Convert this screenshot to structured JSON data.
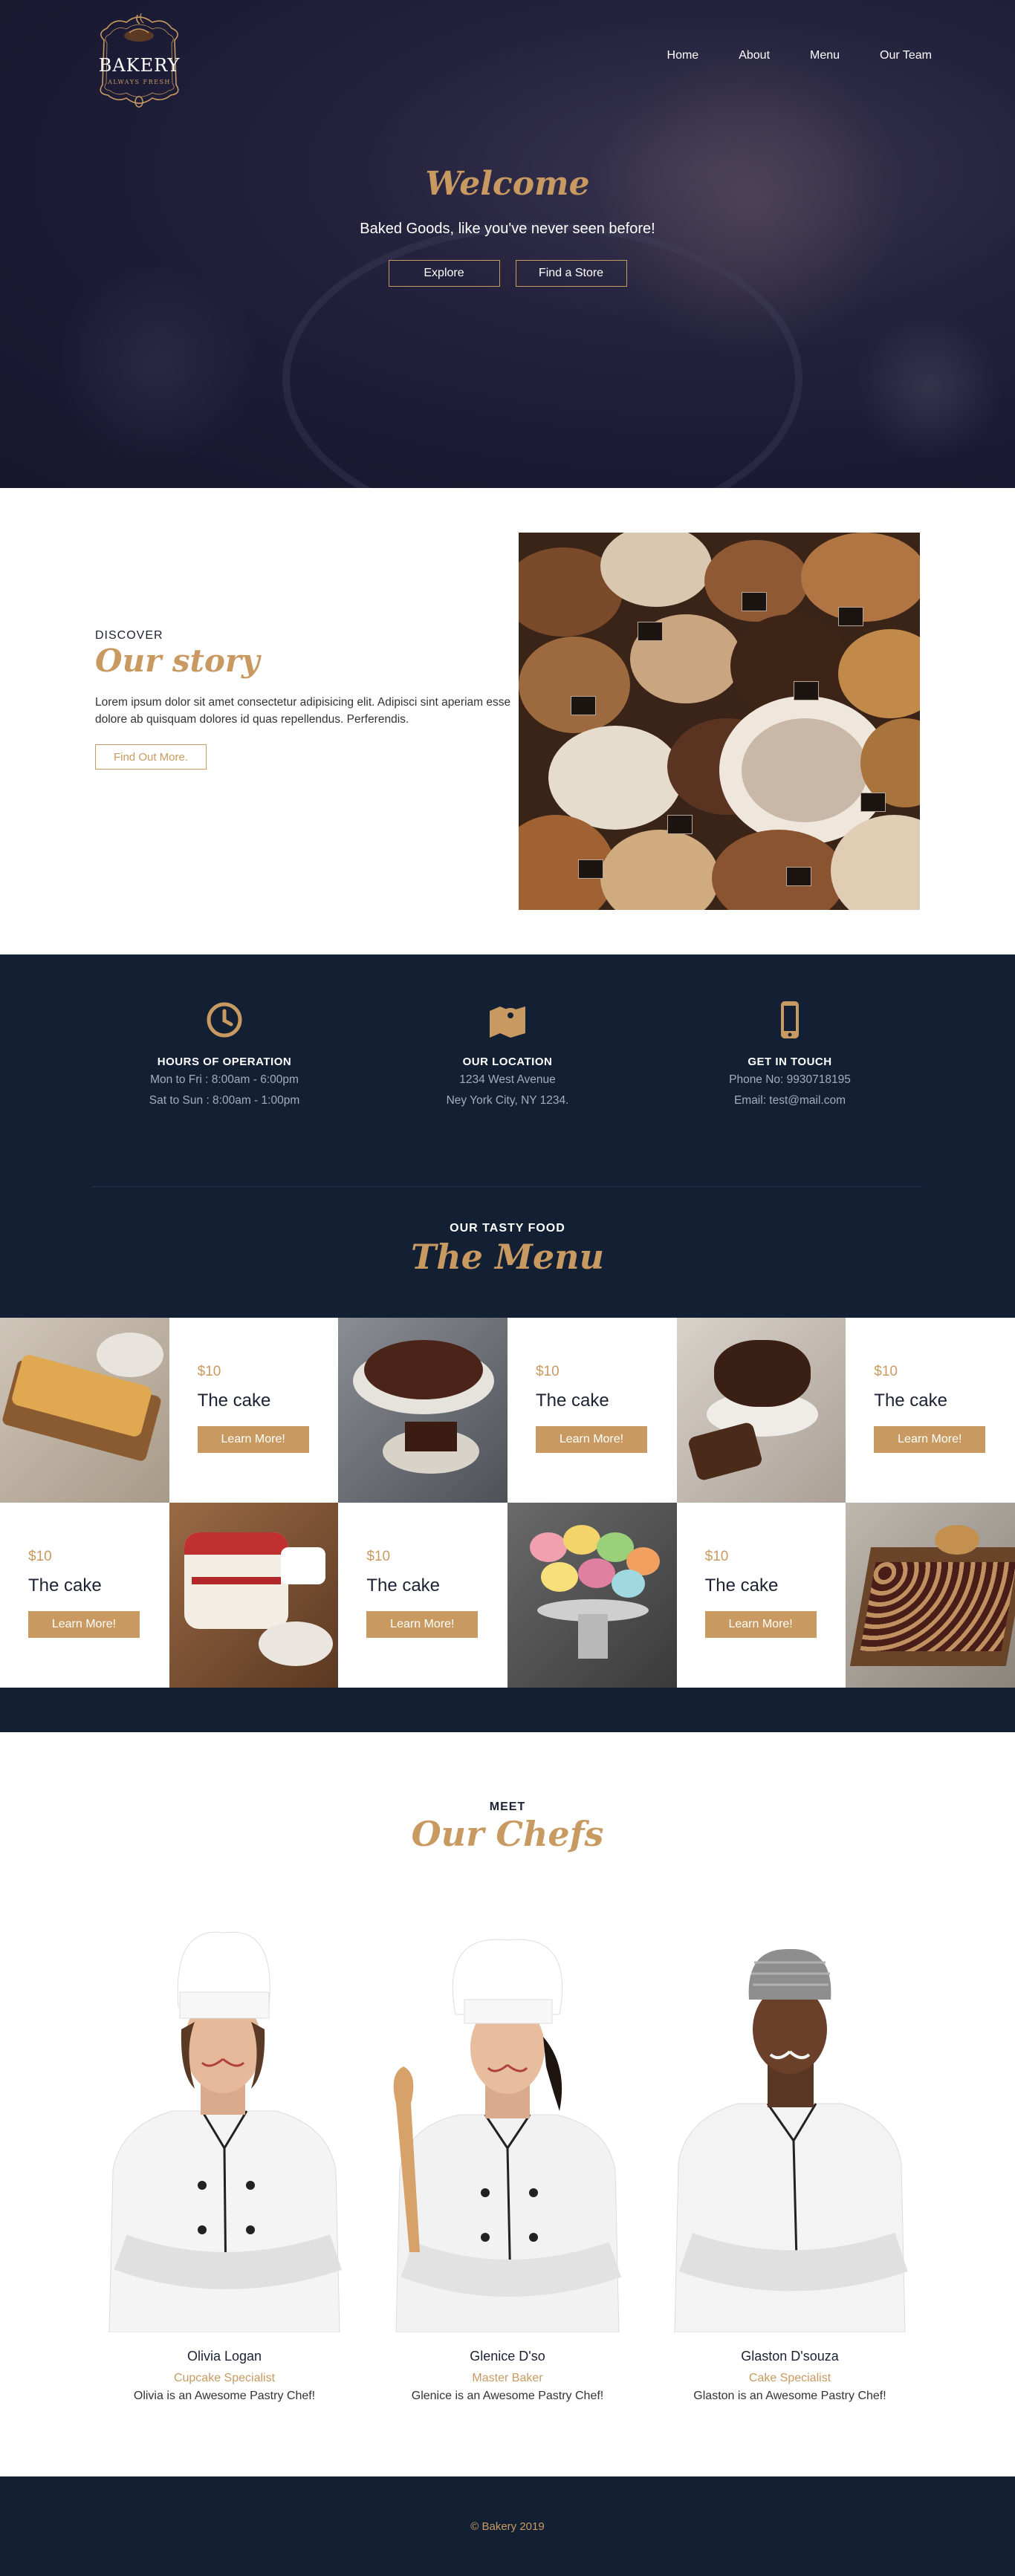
{
  "brand": {
    "name": "BAKERY",
    "tagline": "ALWAYS FRESH"
  },
  "nav": [
    {
      "label": "Home"
    },
    {
      "label": "About"
    },
    {
      "label": "Menu"
    },
    {
      "label": "Our Team"
    }
  ],
  "hero": {
    "title": "Welcome",
    "subtitle": "Baked Goods, like you've never seen before!",
    "buttons": [
      {
        "label": "Explore"
      },
      {
        "label": "Find a Store"
      }
    ]
  },
  "story": {
    "eyebrow": "DISCOVER",
    "title": "Our story",
    "body": "Lorem ipsum dolor sit amet consectetur adipisicing elit. Adipisci sint aperiam esse dolore ab quisquam dolores id quas repellendus. Perferendis.",
    "button": "Find Out More."
  },
  "info": [
    {
      "icon": "clock-icon",
      "title": "HOURS OF OPERATION",
      "lines": [
        "Mon to Fri : 8:00am - 6:00pm",
        "Sat to Sun : 8:00am - 1:00pm"
      ]
    },
    {
      "icon": "map-pin-icon",
      "title": "OUR LOCATION",
      "lines": [
        "1234 West Avenue",
        "Ney York City, NY 1234."
      ]
    },
    {
      "icon": "phone-icon",
      "title": "GET IN TOUCH",
      "lines": [
        "Phone No: 9930718195",
        "Email: test@mail.com"
      ]
    }
  ],
  "menu": {
    "eyebrow": "OUR TASTY FOOD",
    "title": "The Menu",
    "items": [
      {
        "price": "$10",
        "name": "The cake",
        "button": "Learn More!"
      },
      {
        "price": "$10",
        "name": "The cake",
        "button": "Learn More!"
      },
      {
        "price": "$10",
        "name": "The cake",
        "button": "Learn More!"
      },
      {
        "price": "$10",
        "name": "The cake",
        "button": "Learn More!"
      },
      {
        "price": "$10",
        "name": "The cake",
        "button": "Learn More!"
      },
      {
        "price": "$10",
        "name": "The cake",
        "button": "Learn More!"
      }
    ]
  },
  "chefs": {
    "eyebrow": "MEET",
    "title": "Our Chefs",
    "people": [
      {
        "name": "Olivia Logan",
        "role": "Cupcake Specialist",
        "bio": "Olivia is an Awesome Pastry Chef!"
      },
      {
        "name": "Glenice D'so",
        "role": "Master Baker",
        "bio": "Glenice is an Awesome Pastry Chef!"
      },
      {
        "name": "Glaston D'souza",
        "role": "Cake Specialist",
        "bio": "Glaston is an Awesome Pastry Chef!"
      }
    ]
  },
  "footer": {
    "copyright": "© Bakery 2019"
  },
  "colors": {
    "accent": "#c89a62",
    "navy": "#132033",
    "hero": "#1a1a34"
  }
}
